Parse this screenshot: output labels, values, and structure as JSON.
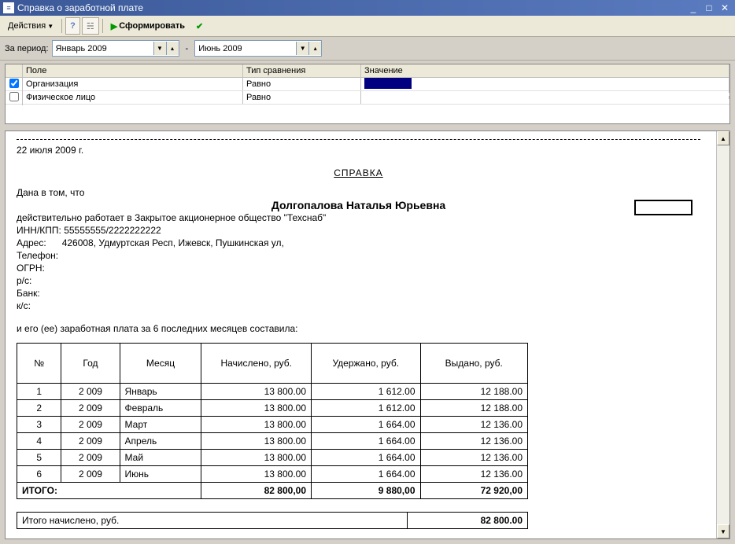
{
  "window": {
    "title": "Справка о заработной плате"
  },
  "toolbar": {
    "actions": "Действия",
    "generate": "Сформировать"
  },
  "period": {
    "label": "За период:",
    "from": "Январь 2009",
    "dash": "-",
    "to": "Июнь 2009"
  },
  "filter": {
    "headers": {
      "field": "Поле",
      "cmp": "Тип сравнения",
      "val": "Значение"
    },
    "rows": [
      {
        "checked": true,
        "field": "Организация",
        "cmp": "Равно",
        "sel": true
      },
      {
        "checked": false,
        "field": "Физическое лицо",
        "cmp": "Равно",
        "sel": false
      }
    ]
  },
  "report": {
    "date": "22 июля 2009 г.",
    "title": "СПРАВКА",
    "given": "Дана в том, что",
    "person": "Долгопалова Наталья Юрьевна",
    "works": "действительно работает в Закрытое акционерное общество \"Техснаб\"",
    "inn": "ИНН/КПП: 55555555/2222222222",
    "addr": "Адрес:      426008, Удмуртская Респ, Ижевск, Пушкинская ул,",
    "tel": "Телефон:",
    "ogrn": "ОГРН:",
    "rs": "р/с:",
    "bank": "Банк:",
    "ks": "к/с:",
    "salary_intro": "и его (ее) заработная плата за  6 последних месяцев составила:",
    "th": {
      "n": "№",
      "year": "Год",
      "month": "Месяц",
      "acc": "Начислено, руб.",
      "hold": "Удержано, руб.",
      "paid": "Выдано, руб."
    },
    "rows": [
      {
        "n": "1",
        "year": "2 009",
        "month": "Январь",
        "acc": "13 800.00",
        "hold": "1 612.00",
        "paid": "12 188.00"
      },
      {
        "n": "2",
        "year": "2 009",
        "month": "Февраль",
        "acc": "13 800.00",
        "hold": "1 612.00",
        "paid": "12 188.00"
      },
      {
        "n": "3",
        "year": "2 009",
        "month": "Март",
        "acc": "13 800.00",
        "hold": "1 664.00",
        "paid": "12 136.00"
      },
      {
        "n": "4",
        "year": "2 009",
        "month": "Апрель",
        "acc": "13 800.00",
        "hold": "1 664.00",
        "paid": "12 136.00"
      },
      {
        "n": "5",
        "year": "2 009",
        "month": "Май",
        "acc": "13 800.00",
        "hold": "1 664.00",
        "paid": "12 136.00"
      },
      {
        "n": "6",
        "year": "2 009",
        "month": "Июнь",
        "acc": "13 800.00",
        "hold": "1 664.00",
        "paid": "12 136.00"
      }
    ],
    "total": {
      "label": "ИТОГО:",
      "acc": "82 800,00",
      "hold": "9 880,00",
      "paid": "72 920,00"
    },
    "summary": {
      "label": "Итого начислено, руб.",
      "value": "82 800.00"
    }
  }
}
